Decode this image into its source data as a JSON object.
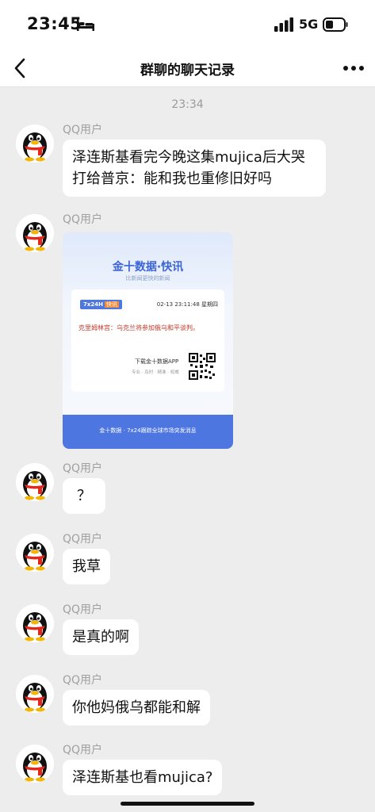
{
  "status_bar": {
    "time": "23:45",
    "network": "5G"
  },
  "nav": {
    "title": "群聊的聊天记录"
  },
  "chat": {
    "timestamp": "23:34",
    "messages": [
      {
        "sender": "QQ用户",
        "text": "泽连斯基看完今晚这集mujica后大哭打给普京：能和我也重修旧好吗"
      },
      {
        "sender": "QQ用户",
        "card": {
          "brand": "金十数据·快讯",
          "slogan": "比新闻更快的新闻",
          "badge": "7x24H",
          "badge_tag": "快讯",
          "datetime": "02-13 23:11:48 星期四",
          "headline": "克里姆林宫：乌克兰将参加俄乌和平谈判。",
          "download": "下载金十数据APP",
          "download_sub": "专业 · 及时 · 精准 · 权威",
          "footer": "金十数据 · 7x24跟踪全球市场突发消息"
        }
      },
      {
        "sender": "QQ用户",
        "text": "？"
      },
      {
        "sender": "QQ用户",
        "text": "我草"
      },
      {
        "sender": "QQ用户",
        "text": "是真的啊"
      },
      {
        "sender": "QQ用户",
        "text": "你他妈俄乌都能和解"
      },
      {
        "sender": "QQ用户",
        "text": "泽连斯基也看mujica?"
      }
    ]
  },
  "icons": {
    "back": "chevron-left-icon",
    "more": "more-dots-icon",
    "avatar": "qq-penguin-avatar"
  }
}
